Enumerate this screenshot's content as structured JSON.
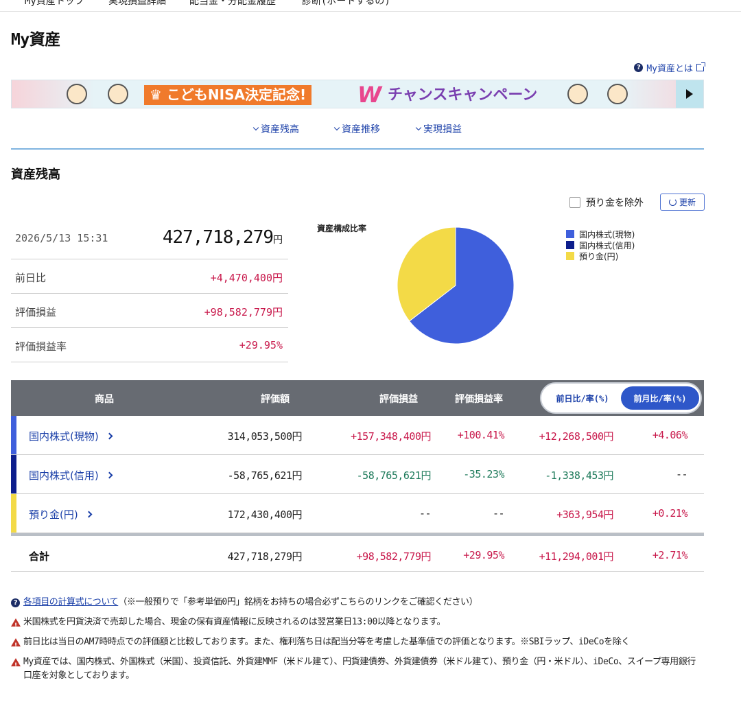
{
  "topnav": {
    "items": [
      "My資産トップ",
      "実現損益詳細",
      "配当金・分配金履歴",
      "診断(ポートするの)"
    ]
  },
  "page_title": "My資産",
  "help_link": "My資産とは",
  "banner": {
    "box_text": "こどもNISA決定記念!",
    "w_text": "W",
    "campaign_text": "チャンスキャンペーン"
  },
  "anchors": [
    "資産残高",
    "資産推移",
    "実現損益"
  ],
  "section_title": "資産残高",
  "exclude_label": "預り金を除外",
  "refresh_label": "更新",
  "summary": {
    "datetime": "2026/5/13 15:31",
    "total": "427,718,279",
    "total_unit": "円",
    "rows": [
      {
        "label": "前日比",
        "value": "+4,470,400円"
      },
      {
        "label": "評価損益",
        "value": "+98,582,779円"
      },
      {
        "label": "評価損益率",
        "value": "+29.95%"
      }
    ]
  },
  "chart_data": {
    "type": "pie",
    "title": "資産構成比率",
    "labels": [
      "国内株式(現物)",
      "国内株式(信用)",
      "預り金(円)"
    ],
    "values": [
      314053500,
      0,
      172430400
    ],
    "colors": [
      "#3f5fdc",
      "#0d1e8c",
      "#f3da47"
    ],
    "legend_position": "right"
  },
  "table": {
    "headers": [
      "商品",
      "評価額",
      "評価損益",
      "評価損益率"
    ],
    "toggle": {
      "off": "前日比/率(%)",
      "on": "前月比/率(%)"
    },
    "rows": [
      {
        "name": "国内株式(現物)",
        "color": "#3f5fdc",
        "value": "314,053,500円",
        "pl": "+157,348,400円",
        "pl_rate": "+100.41%",
        "change": "+12,268,500円",
        "change_rate": "+4.06%"
      },
      {
        "name": "国内株式(信用)",
        "color": "#0d1e8c",
        "value": "-58,765,621円",
        "pl": "-58,765,621円",
        "pl_rate": "-35.23%",
        "change": "-1,338,453円",
        "change_rate": "--"
      },
      {
        "name": "預り金(円)",
        "color": "#f3da47",
        "value": "172,430,400円",
        "pl": "--",
        "pl_rate": "--",
        "change": "+363,954円",
        "change_rate": "+0.21%"
      }
    ],
    "total": {
      "name": "合計",
      "value": "427,718,279円",
      "pl": "+98,582,779円",
      "pl_rate": "+29.95%",
      "change": "+11,294,001円",
      "change_rate": "+2.71%"
    }
  },
  "notes": {
    "link_text": "各項目の計算式について",
    "link_suffix": "（※一般預りで「参考単価0円」銘柄をお持ちの場合必ずこちらのリンクをご確認ください）",
    "warnings": [
      "米国株式を円貨決済で売却した場合、現金の保有資産情報に反映されるのは翌営業日13:00以降となります。",
      "前日比は当日のAM7時時点での評価額と比較しております。また、権利落ち日は配当分等を考慮した基準値での評価となります。※SBIラップ、iDeCoを除く",
      "My資産では、国内株式、外国株式（米国）、投資信託、外貨建MMF（米ドル建て）、円貨建債券、外貨建債券（米ドル建て）、預り金（円・米ドル）、iDeCo、スイープ専用銀行口座を対象としております。"
    ]
  }
}
